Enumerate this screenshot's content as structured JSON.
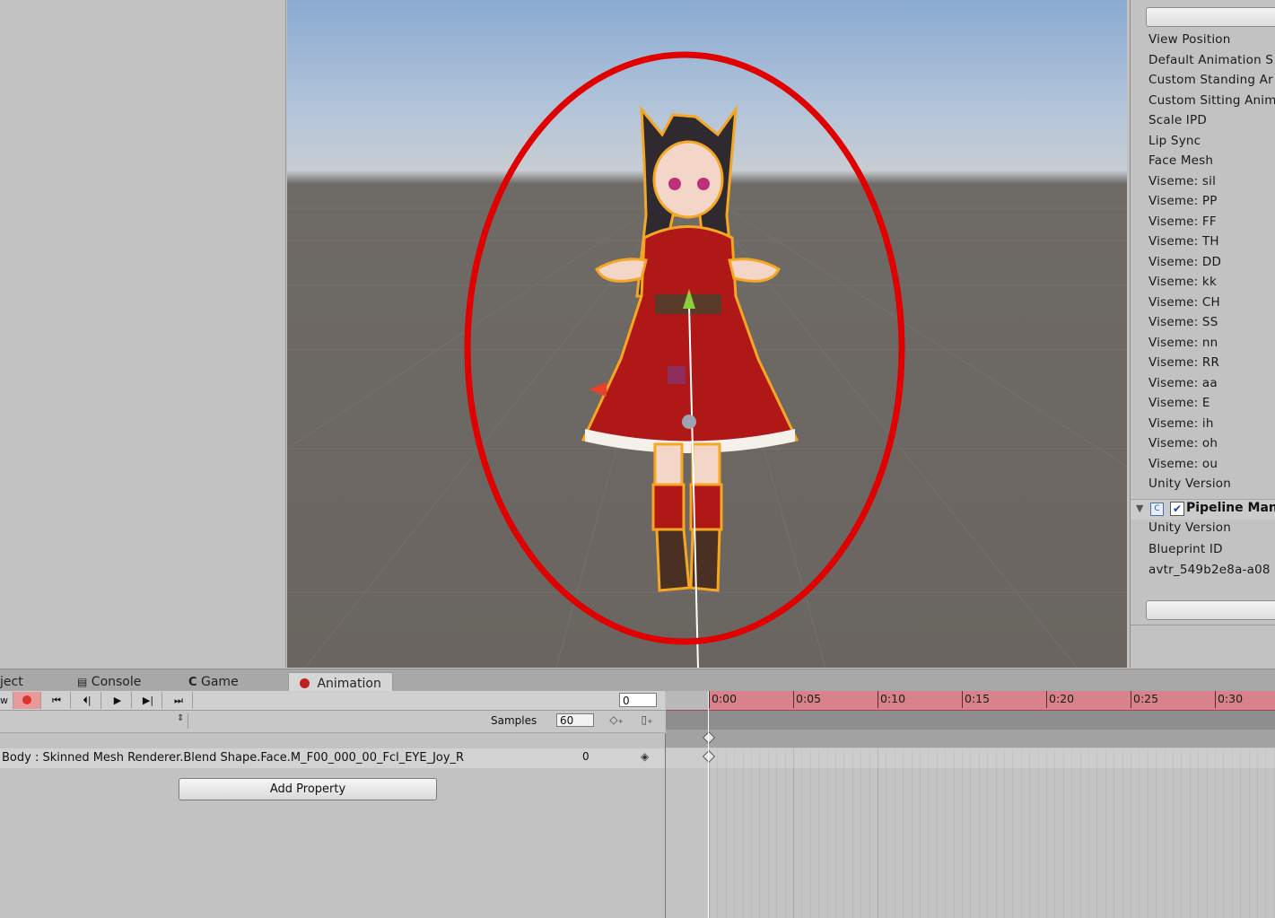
{
  "inspector": {
    "partial_header": "...",
    "avatar_fields": [
      "View Position",
      "Default Animation S",
      "Custom Standing Ar",
      "Custom Sitting Anim",
      "Scale IPD",
      "Lip Sync",
      "Face Mesh",
      "Viseme: sil",
      "Viseme: PP",
      "Viseme: FF",
      "Viseme: TH",
      "Viseme: DD",
      "Viseme: kk",
      "Viseme: CH",
      "Viseme: SS",
      "Viseme: nn",
      "Viseme: RR",
      "Viseme: aa",
      "Viseme: E",
      "Viseme: ih",
      "Viseme: oh",
      "Viseme: ou",
      "Unity Version"
    ],
    "pipeline_component": {
      "title": "Pipeline Man",
      "enabled": true,
      "fields": [
        "Unity Version",
        "Blueprint ID",
        "avtr_549b2e8a-a08"
      ]
    }
  },
  "tabs": [
    {
      "label": "ject",
      "icon": "project-icon"
    },
    {
      "label": "Console",
      "icon": "console-icon"
    },
    {
      "label": "Game",
      "icon": "game-icon"
    },
    {
      "label": "Animation",
      "icon": "animation-icon",
      "active": true
    }
  ],
  "animation": {
    "preview_label": "w",
    "current_frame": "0",
    "samples_label": "Samples",
    "samples_value": "60",
    "property_path": "Body : Skinned Mesh Renderer.Blend Shape.Face.M_F00_000_00_Fcl_EYE_Joy_R",
    "property_value": "0",
    "add_property_label": "Add Property",
    "timeline_ticks": [
      "0:00",
      "0:05",
      "0:10",
      "0:15",
      "0:20",
      "0:25",
      "0:30"
    ]
  },
  "colors": {
    "record_red": "#e03030",
    "ruler_recording": "#d8838b",
    "highlight_ellipse": "#e00000",
    "selection_outline": "#f5a623"
  }
}
